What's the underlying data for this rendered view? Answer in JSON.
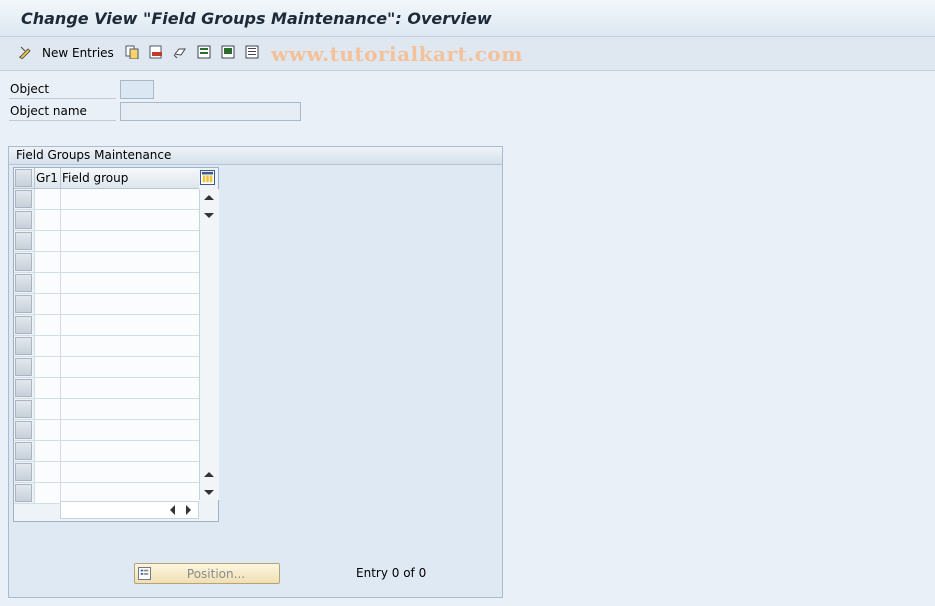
{
  "title": "Change View \"Field Groups Maintenance\": Overview",
  "toolbar": {
    "new_entries_label": "New Entries",
    "icons": [
      "edit-icon",
      "copy-icon",
      "delete-icon",
      "undo-icon",
      "select-all-icon",
      "select-block-icon",
      "deselect-all-icon"
    ]
  },
  "watermark": "www.tutorialkart.com",
  "form": {
    "object_label": "Object",
    "object_value": "",
    "object_name_label": "Object name",
    "object_name_value": ""
  },
  "group": {
    "title": "Field Groups Maintenance",
    "columns": [
      "Gr1",
      "Field group"
    ],
    "rows": [
      [
        "",
        ""
      ],
      [
        "",
        ""
      ],
      [
        "",
        ""
      ],
      [
        "",
        ""
      ],
      [
        "",
        ""
      ],
      [
        "",
        ""
      ],
      [
        "",
        ""
      ],
      [
        "",
        ""
      ],
      [
        "",
        ""
      ],
      [
        "",
        ""
      ],
      [
        "",
        ""
      ],
      [
        "",
        ""
      ],
      [
        "",
        ""
      ],
      [
        "",
        ""
      ],
      [
        "",
        ""
      ]
    ]
  },
  "footer": {
    "position_label": "Position...",
    "entry_text": "Entry 0 of 0"
  },
  "colors": {
    "background": "#e9f0f7",
    "watermark": "#f3c19a",
    "button": "#efe0b3"
  }
}
